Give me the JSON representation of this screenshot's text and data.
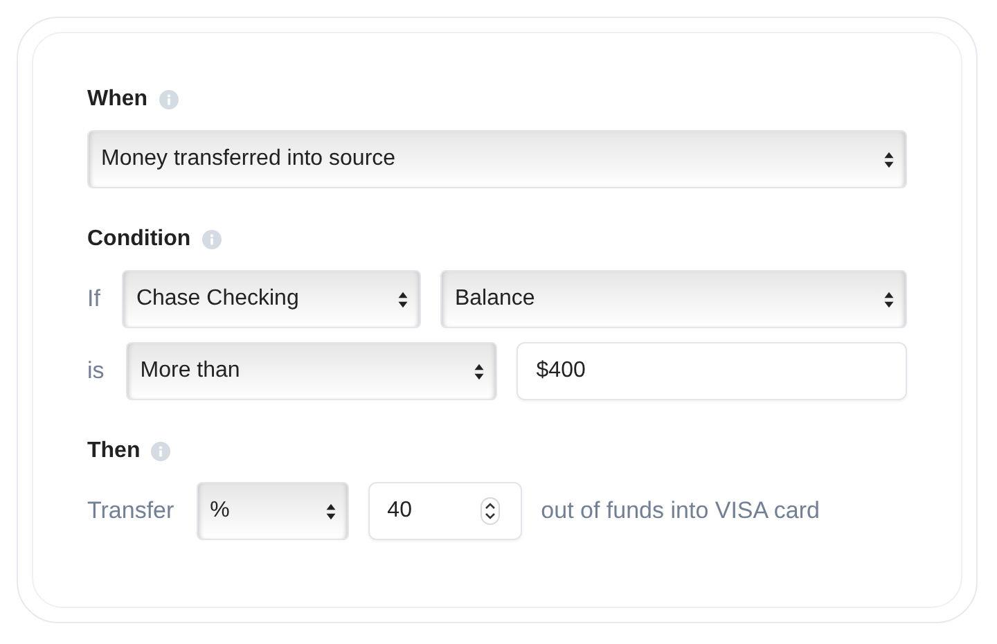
{
  "sections": [
    {
      "title": "When",
      "rows": [
        {
          "fields": [
            {
              "kind": "select",
              "value": "Money transferred into source"
            }
          ]
        }
      ]
    },
    {
      "title": "Condition",
      "rows": [
        {
          "label": "If",
          "fields": [
            {
              "kind": "select",
              "value": "Chase Checking"
            },
            {
              "kind": "select",
              "value": "Balance"
            }
          ]
        },
        {
          "label": "is",
          "fields": [
            {
              "kind": "select",
              "value": "More than"
            },
            {
              "kind": "text",
              "value": "$400"
            }
          ]
        }
      ]
    },
    {
      "title": "Then",
      "rows": [
        {
          "label": "Transfer",
          "fields": [
            {
              "kind": "select",
              "value": "%"
            },
            {
              "kind": "number",
              "value": "40"
            }
          ],
          "suffix": "out of funds into VISA card"
        }
      ]
    }
  ]
}
